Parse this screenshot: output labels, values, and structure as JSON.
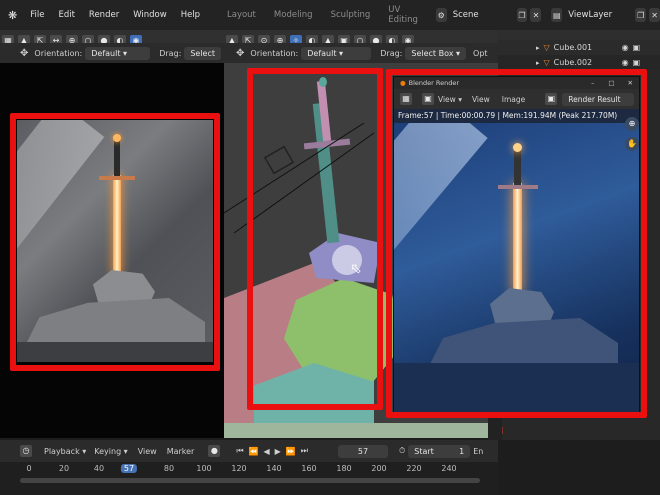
{
  "topbar": {
    "menus": [
      "File",
      "Edit",
      "Render",
      "Window",
      "Help"
    ],
    "workspaces": [
      "Layout",
      "Modeling",
      "Sculpting",
      "UV Editing"
    ],
    "scene_label": "Scene",
    "viewlayer_label": "ViewLayer"
  },
  "left_viewport": {
    "orientation_label": "Orientation:",
    "orientation_value": "Default",
    "drag_label": "Drag:",
    "drag_value": "Select"
  },
  "mid_viewport": {
    "orientation_label": "Orientation:",
    "orientation_value": "Default",
    "drag_label": "Drag:",
    "drag_value": "Select Box",
    "options_label": "Opt"
  },
  "outliner": {
    "items": [
      "Cube.001",
      "Cube.002"
    ]
  },
  "render_window": {
    "title": "Blender Render",
    "view_menu": "View",
    "view_btn": "View",
    "image_btn": "Image",
    "slot": "Render Result",
    "info": "Frame:57 | Time:00:00.79 | Mem:191.94M (Peak 217.70M)"
  },
  "timeline": {
    "playback_label": "Playback",
    "keying_label": "Keying",
    "view_label": "View",
    "marker_label": "Marker",
    "current_frame": "57",
    "start_label": "Start",
    "start_value": "1",
    "end_label": "En",
    "ticks": [
      "0",
      "20",
      "40",
      "57",
      "80",
      "100",
      "120",
      "140",
      "160",
      "180",
      "200",
      "220",
      "240"
    ]
  },
  "colors": {
    "highlight_red": "#ea1010",
    "accent_blue": "#4772b3"
  }
}
